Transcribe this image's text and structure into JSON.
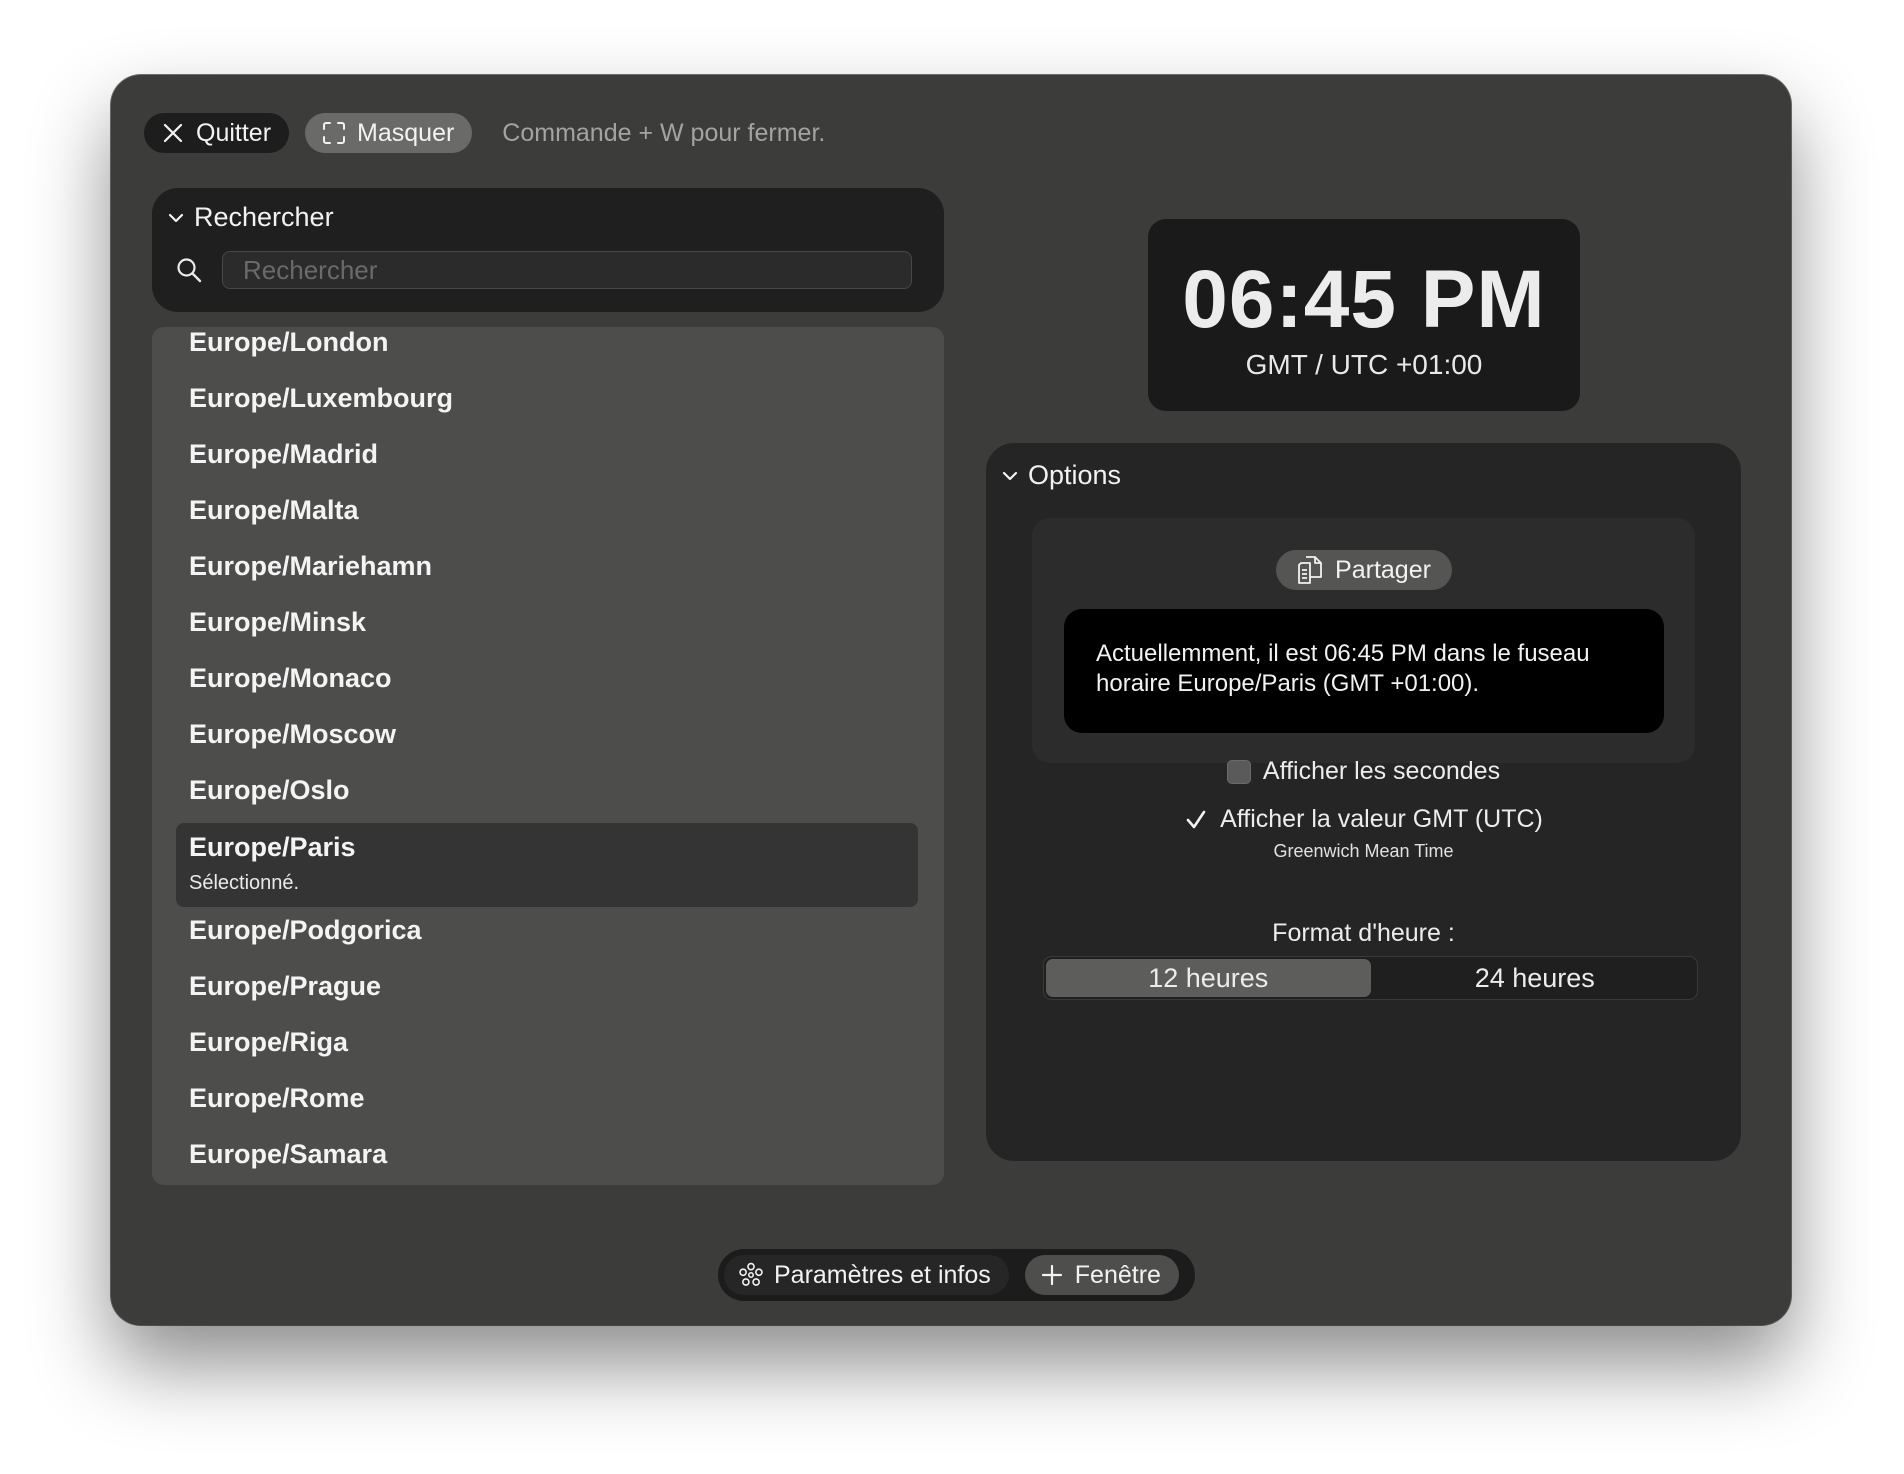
{
  "toolbar": {
    "quit_label": "Quitter",
    "hide_label": "Masquer",
    "hint": "Commande + W pour fermer."
  },
  "search": {
    "section_label": "Rechercher",
    "placeholder": "Rechercher",
    "value": ""
  },
  "timezones": [
    "Europe/London",
    "Europe/Luxembourg",
    "Europe/Madrid",
    "Europe/Malta",
    "Europe/Mariehamn",
    "Europe/Minsk",
    "Europe/Monaco",
    "Europe/Moscow",
    "Europe/Oslo",
    "Europe/Paris",
    "Europe/Podgorica",
    "Europe/Prague",
    "Europe/Riga",
    "Europe/Rome",
    "Europe/Samara"
  ],
  "selected": {
    "name": "Europe/Paris",
    "status": "Sélectionné."
  },
  "clock": {
    "time": "06:45 PM",
    "offset": "GMT / UTC +01:00"
  },
  "options": {
    "section_label": "Options",
    "share_label": "Partager",
    "share_text": "Actuellemment, il est 06:45 PM dans le fuseau horaire Europe/Paris (GMT +01:00).",
    "show_seconds_label": "Afficher les secondes",
    "show_seconds_checked": false,
    "show_gmt_label": "Afficher la valeur GMT (UTC)",
    "show_gmt_checked": true,
    "gmt_caption": "Greenwich Mean Time",
    "format_label": "Format d'heure :",
    "format_12": "12 heures",
    "format_24": "24 heures",
    "format_selected": "12 heures"
  },
  "footer": {
    "settings_label": "Paramètres et infos",
    "window_label": "Fenêtre"
  },
  "colors": {
    "window_bg": "#3c3c3a",
    "card_bg": "#1f1f1f",
    "list_bg": "#4d4d4c",
    "selected_bg": "#343434",
    "text": "#f2f2f2",
    "muted_text": "#a3a3a1"
  },
  "icons": {
    "quit": "close-icon",
    "hide": "expand-corners-icon",
    "search": "search-icon",
    "disclosure": "chevron-down-icon",
    "share": "copy-documents-icon",
    "check": "checkmark-icon",
    "settings": "flower-settings-icon",
    "add": "plus-icon"
  }
}
